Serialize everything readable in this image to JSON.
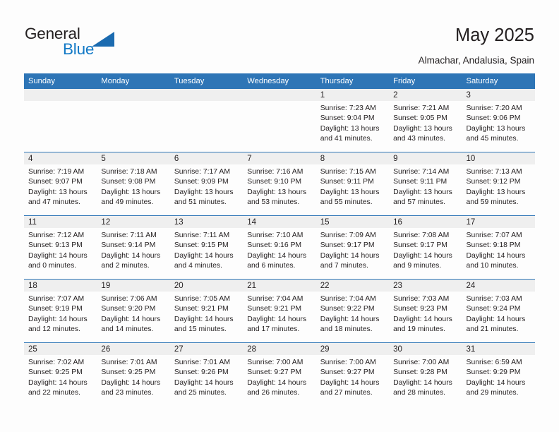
{
  "brand": {
    "name_top": "General",
    "name_bottom": "Blue",
    "accent_color": "#1279c6",
    "triangle_color": "#1b6bb0"
  },
  "header": {
    "title": "May 2025",
    "subtitle": "Almachar, Andalusia, Spain"
  },
  "calendar": {
    "header_bg": "#2e75b6",
    "daynum_bg": "#efefef",
    "weekdays": [
      "Sunday",
      "Monday",
      "Tuesday",
      "Wednesday",
      "Thursday",
      "Friday",
      "Saturday"
    ],
    "weeks": [
      [
        {
          "day": "",
          "sunrise": "",
          "sunset": "",
          "daylight1": "",
          "daylight2": ""
        },
        {
          "day": "",
          "sunrise": "",
          "sunset": "",
          "daylight1": "",
          "daylight2": ""
        },
        {
          "day": "",
          "sunrise": "",
          "sunset": "",
          "daylight1": "",
          "daylight2": ""
        },
        {
          "day": "",
          "sunrise": "",
          "sunset": "",
          "daylight1": "",
          "daylight2": ""
        },
        {
          "day": "1",
          "sunrise": "Sunrise: 7:23 AM",
          "sunset": "Sunset: 9:04 PM",
          "daylight1": "Daylight: 13 hours",
          "daylight2": "and 41 minutes."
        },
        {
          "day": "2",
          "sunrise": "Sunrise: 7:21 AM",
          "sunset": "Sunset: 9:05 PM",
          "daylight1": "Daylight: 13 hours",
          "daylight2": "and 43 minutes."
        },
        {
          "day": "3",
          "sunrise": "Sunrise: 7:20 AM",
          "sunset": "Sunset: 9:06 PM",
          "daylight1": "Daylight: 13 hours",
          "daylight2": "and 45 minutes."
        }
      ],
      [
        {
          "day": "4",
          "sunrise": "Sunrise: 7:19 AM",
          "sunset": "Sunset: 9:07 PM",
          "daylight1": "Daylight: 13 hours",
          "daylight2": "and 47 minutes."
        },
        {
          "day": "5",
          "sunrise": "Sunrise: 7:18 AM",
          "sunset": "Sunset: 9:08 PM",
          "daylight1": "Daylight: 13 hours",
          "daylight2": "and 49 minutes."
        },
        {
          "day": "6",
          "sunrise": "Sunrise: 7:17 AM",
          "sunset": "Sunset: 9:09 PM",
          "daylight1": "Daylight: 13 hours",
          "daylight2": "and 51 minutes."
        },
        {
          "day": "7",
          "sunrise": "Sunrise: 7:16 AM",
          "sunset": "Sunset: 9:10 PM",
          "daylight1": "Daylight: 13 hours",
          "daylight2": "and 53 minutes."
        },
        {
          "day": "8",
          "sunrise": "Sunrise: 7:15 AM",
          "sunset": "Sunset: 9:11 PM",
          "daylight1": "Daylight: 13 hours",
          "daylight2": "and 55 minutes."
        },
        {
          "day": "9",
          "sunrise": "Sunrise: 7:14 AM",
          "sunset": "Sunset: 9:11 PM",
          "daylight1": "Daylight: 13 hours",
          "daylight2": "and 57 minutes."
        },
        {
          "day": "10",
          "sunrise": "Sunrise: 7:13 AM",
          "sunset": "Sunset: 9:12 PM",
          "daylight1": "Daylight: 13 hours",
          "daylight2": "and 59 minutes."
        }
      ],
      [
        {
          "day": "11",
          "sunrise": "Sunrise: 7:12 AM",
          "sunset": "Sunset: 9:13 PM",
          "daylight1": "Daylight: 14 hours",
          "daylight2": "and 0 minutes."
        },
        {
          "day": "12",
          "sunrise": "Sunrise: 7:11 AM",
          "sunset": "Sunset: 9:14 PM",
          "daylight1": "Daylight: 14 hours",
          "daylight2": "and 2 minutes."
        },
        {
          "day": "13",
          "sunrise": "Sunrise: 7:11 AM",
          "sunset": "Sunset: 9:15 PM",
          "daylight1": "Daylight: 14 hours",
          "daylight2": "and 4 minutes."
        },
        {
          "day": "14",
          "sunrise": "Sunrise: 7:10 AM",
          "sunset": "Sunset: 9:16 PM",
          "daylight1": "Daylight: 14 hours",
          "daylight2": "and 6 minutes."
        },
        {
          "day": "15",
          "sunrise": "Sunrise: 7:09 AM",
          "sunset": "Sunset: 9:17 PM",
          "daylight1": "Daylight: 14 hours",
          "daylight2": "and 7 minutes."
        },
        {
          "day": "16",
          "sunrise": "Sunrise: 7:08 AM",
          "sunset": "Sunset: 9:17 PM",
          "daylight1": "Daylight: 14 hours",
          "daylight2": "and 9 minutes."
        },
        {
          "day": "17",
          "sunrise": "Sunrise: 7:07 AM",
          "sunset": "Sunset: 9:18 PM",
          "daylight1": "Daylight: 14 hours",
          "daylight2": "and 10 minutes."
        }
      ],
      [
        {
          "day": "18",
          "sunrise": "Sunrise: 7:07 AM",
          "sunset": "Sunset: 9:19 PM",
          "daylight1": "Daylight: 14 hours",
          "daylight2": "and 12 minutes."
        },
        {
          "day": "19",
          "sunrise": "Sunrise: 7:06 AM",
          "sunset": "Sunset: 9:20 PM",
          "daylight1": "Daylight: 14 hours",
          "daylight2": "and 14 minutes."
        },
        {
          "day": "20",
          "sunrise": "Sunrise: 7:05 AM",
          "sunset": "Sunset: 9:21 PM",
          "daylight1": "Daylight: 14 hours",
          "daylight2": "and 15 minutes."
        },
        {
          "day": "21",
          "sunrise": "Sunrise: 7:04 AM",
          "sunset": "Sunset: 9:21 PM",
          "daylight1": "Daylight: 14 hours",
          "daylight2": "and 17 minutes."
        },
        {
          "day": "22",
          "sunrise": "Sunrise: 7:04 AM",
          "sunset": "Sunset: 9:22 PM",
          "daylight1": "Daylight: 14 hours",
          "daylight2": "and 18 minutes."
        },
        {
          "day": "23",
          "sunrise": "Sunrise: 7:03 AM",
          "sunset": "Sunset: 9:23 PM",
          "daylight1": "Daylight: 14 hours",
          "daylight2": "and 19 minutes."
        },
        {
          "day": "24",
          "sunrise": "Sunrise: 7:03 AM",
          "sunset": "Sunset: 9:24 PM",
          "daylight1": "Daylight: 14 hours",
          "daylight2": "and 21 minutes."
        }
      ],
      [
        {
          "day": "25",
          "sunrise": "Sunrise: 7:02 AM",
          "sunset": "Sunset: 9:25 PM",
          "daylight1": "Daylight: 14 hours",
          "daylight2": "and 22 minutes."
        },
        {
          "day": "26",
          "sunrise": "Sunrise: 7:01 AM",
          "sunset": "Sunset: 9:25 PM",
          "daylight1": "Daylight: 14 hours",
          "daylight2": "and 23 minutes."
        },
        {
          "day": "27",
          "sunrise": "Sunrise: 7:01 AM",
          "sunset": "Sunset: 9:26 PM",
          "daylight1": "Daylight: 14 hours",
          "daylight2": "and 25 minutes."
        },
        {
          "day": "28",
          "sunrise": "Sunrise: 7:00 AM",
          "sunset": "Sunset: 9:27 PM",
          "daylight1": "Daylight: 14 hours",
          "daylight2": "and 26 minutes."
        },
        {
          "day": "29",
          "sunrise": "Sunrise: 7:00 AM",
          "sunset": "Sunset: 9:27 PM",
          "daylight1": "Daylight: 14 hours",
          "daylight2": "and 27 minutes."
        },
        {
          "day": "30",
          "sunrise": "Sunrise: 7:00 AM",
          "sunset": "Sunset: 9:28 PM",
          "daylight1": "Daylight: 14 hours",
          "daylight2": "and 28 minutes."
        },
        {
          "day": "31",
          "sunrise": "Sunrise: 6:59 AM",
          "sunset": "Sunset: 9:29 PM",
          "daylight1": "Daylight: 14 hours",
          "daylight2": "and 29 minutes."
        }
      ]
    ]
  }
}
